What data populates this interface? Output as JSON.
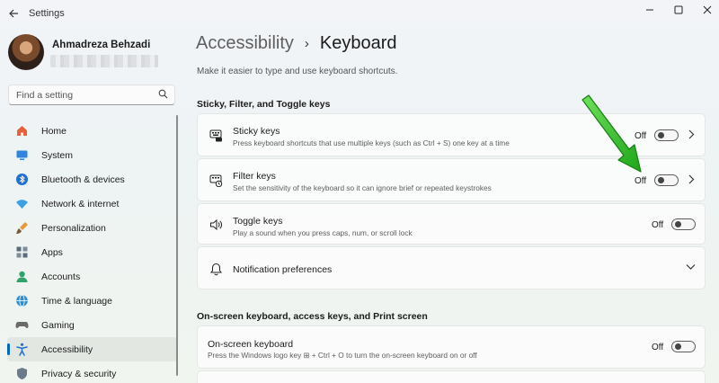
{
  "window": {
    "title": "Settings",
    "controls": [
      "minimize",
      "maximize",
      "close"
    ]
  },
  "user": {
    "name": "Ahmadreza Behzadi"
  },
  "search": {
    "placeholder": "Find a setting"
  },
  "sidebar": {
    "items": [
      {
        "label": "Home",
        "icon": "home-icon",
        "color": "#e8603c"
      },
      {
        "label": "System",
        "icon": "system-icon",
        "color": "#2e86de"
      },
      {
        "label": "Bluetooth & devices",
        "icon": "bluetooth-icon",
        "color": "#1e6fd9"
      },
      {
        "label": "Network & internet",
        "icon": "wifi-icon",
        "color": "#3aa0e8"
      },
      {
        "label": "Personalization",
        "icon": "brush-icon",
        "color": "#e39a3b"
      },
      {
        "label": "Apps",
        "icon": "apps-icon",
        "color": "#5a6b7d"
      },
      {
        "label": "Accounts",
        "icon": "accounts-icon",
        "color": "#2fa36b"
      },
      {
        "label": "Time & language",
        "icon": "globe-icon",
        "color": "#2a8fd6"
      },
      {
        "label": "Gaming",
        "icon": "gamepad-icon",
        "color": "#6b6b6b"
      },
      {
        "label": "Accessibility",
        "icon": "accessibility-icon",
        "color": "#1f6fd0",
        "selected": true
      },
      {
        "label": "Privacy & security",
        "icon": "shield-icon",
        "color": "#6b7b8c"
      }
    ]
  },
  "breadcrumb": {
    "parent": "Accessibility",
    "separator": "›",
    "current": "Keyboard"
  },
  "page": {
    "description": "Make it easier to type and use keyboard shortcuts."
  },
  "sections": [
    {
      "heading": "Sticky, Filter, and Toggle keys",
      "cards": [
        {
          "title": "Sticky keys",
          "desc": "Press keyboard shortcuts that use multiple keys (such as Ctrl + S) one key at a time",
          "state": "Off",
          "has_chevron": true,
          "icon": "sticky-keys-icon"
        },
        {
          "title": "Filter keys",
          "desc": "Set the sensitivity of the keyboard so it can ignore brief or repeated keystrokes",
          "state": "Off",
          "has_chevron": true,
          "icon": "filter-keys-icon"
        },
        {
          "title": "Toggle keys",
          "desc": "Play a sound when you press caps, num, or scroll lock",
          "state": "Off",
          "has_chevron": false,
          "icon": "speaker-icon"
        },
        {
          "title": "Notification preferences",
          "icon": "bell-icon",
          "expandable": true
        }
      ]
    },
    {
      "heading": "On-screen keyboard, access keys, and Print screen",
      "cards": [
        {
          "title": "On-screen keyboard",
          "desc": "Press the Windows logo key ⊞ + Ctrl + O to turn the on-screen keyboard on or off",
          "state": "Off"
        }
      ]
    }
  ],
  "annotation": {
    "color": "#2ebd2a",
    "target": "Filter keys toggle"
  }
}
